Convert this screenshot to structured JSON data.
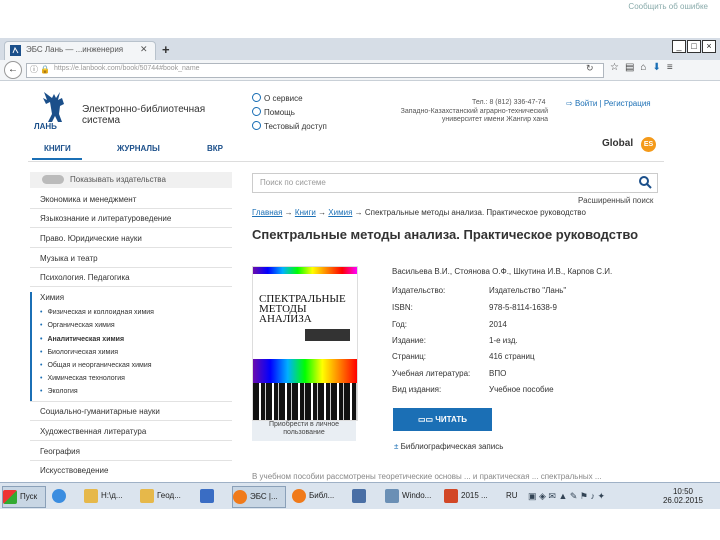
{
  "browser": {
    "report_link": "Сообщить об ошибке",
    "tab_title": "ЭБС Лань — ...инженерия",
    "url": "https://e.lanbook.com/book/50744#book_name",
    "win_controls": [
      "_",
      "□",
      "×"
    ]
  },
  "site": {
    "logo_text": "ЛАНЬ",
    "title": "Электронно-библиотечная система",
    "links": [
      "О сервисе",
      "Помощь",
      "Тестовый доступ"
    ],
    "phone": "Тел.: 8 (812) 336-47-74",
    "org": "Западно-Казахстанский аграрно-технический университет имени Жангир хана",
    "login": "Войти",
    "register": "Регистрация",
    "menu": [
      "КНИГИ",
      "ЖУРНАЛЫ",
      "ВКР"
    ],
    "global": "Global",
    "global_badge": "ES"
  },
  "sidebar": {
    "toggle_label": "Показывать издательства",
    "items": [
      "Экономика и менеджмент",
      "Языкознание и литературоведение",
      "Право. Юридические науки",
      "Музыка и театр",
      "Психология. Педагогика",
      "Химия"
    ],
    "sub_items": [
      "Физическая и коллоидная химия",
      "Органическая химия",
      "Аналитическая химия",
      "Биологическая химия",
      "Общая и неорганическая химия",
      "Химическая технология",
      "Экология"
    ],
    "items_after": [
      "Социально-гуманитарные науки",
      "Художественная литература",
      "География",
      "Искусствоведение"
    ]
  },
  "search": {
    "placeholder": "Поиск по системе",
    "advanced": "Расширенный поиск"
  },
  "breadcrumbs": [
    "Главная",
    "Книги",
    "Химия",
    "Спектральные методы анализа. Практическое руководство"
  ],
  "book": {
    "title": "Спектральные методы анализа. Практическое руководство",
    "authors": "Васильева В.И., Стоянова О.Ф., Шкутина И.В., Карпов С.И.",
    "cover_title": "Спектральные методы анализа",
    "cover_caption": "Приобрести в личное пользование",
    "details": [
      {
        "label": "Издательство:",
        "value": "Издательство \"Лань\""
      },
      {
        "label": "ISBN:",
        "value": "978-5-8114-1638-9"
      },
      {
        "label": "Год:",
        "value": "2014"
      },
      {
        "label": "Издание:",
        "value": "1-е изд."
      },
      {
        "label": "Страниц:",
        "value": "416 страниц"
      },
      {
        "label": "Учебная литература:",
        "value": "ВПО"
      },
      {
        "label": "Вид издания:",
        "value": "Учебное пособие"
      }
    ],
    "read_button": "ЧИТАТЬ",
    "bib_link": "Библиографическая запись"
  },
  "footer_text": "В учебном пособии рассмотрены теоретические основы ... и практическая ... спектральных ...",
  "taskbar": {
    "start": "Пуск",
    "items": [
      "Н:\\д...",
      "Геод...",
      "ЭБС |...",
      "Библ...",
      "Windo...",
      "2015 ..."
    ],
    "lang": "RU",
    "time": "10:50",
    "date": "26.02.2015"
  },
  "colors": {
    "accent": "#1b6fb5",
    "brand": "#1b4f8a",
    "global_orange": "#f49a1a"
  }
}
